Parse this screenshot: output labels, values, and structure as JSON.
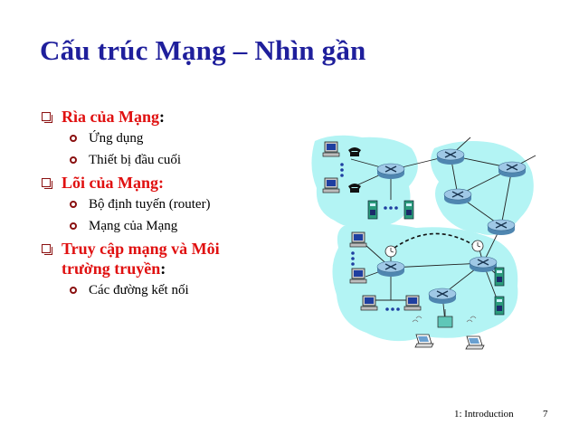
{
  "slide": {
    "title": "Cấu trúc Mạng – Nhìn gần",
    "bullets": [
      {
        "label": "Rìa của Mạng",
        "suffix": ":",
        "subitems": [
          "Ứng dụng",
          "Thiết bị đầu cuối"
        ]
      },
      {
        "label": "Lõi của Mạng:",
        "suffix": "",
        "subitems": [
          "Bộ định tuyến (router)",
          "Mạng của Mạng"
        ]
      },
      {
        "label_line1": "Truy cập mạng và Môi",
        "label_line2": "trường truyền",
        "suffix": ":",
        "subitems": [
          "Các đường kết nối"
        ]
      }
    ],
    "footer": {
      "chapter": "1: Introduction",
      "page": "7"
    }
  },
  "colors": {
    "title": "#1f1f9c",
    "bullet_text": "#e01010",
    "cloud": "#b3f4f4",
    "router": "#7fb3d6"
  }
}
